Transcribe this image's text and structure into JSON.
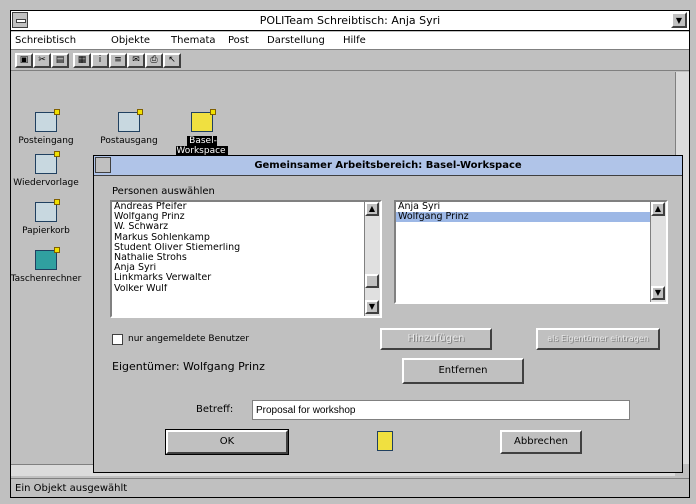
{
  "window": {
    "title": "POLITeam Schreibtisch: Anja Syri"
  },
  "menu": [
    "Schreibtisch",
    "Objekte",
    "Themata",
    "Post",
    "Darstellung",
    "Hilfe"
  ],
  "desktop_icons": [
    {
      "label": "Posteingang"
    },
    {
      "label": "Postausgang"
    },
    {
      "label": "Basel-Workspace"
    },
    {
      "label": "Wiedervorlage"
    },
    {
      "label": "Papierkorb"
    },
    {
      "label": "Taschenrechner"
    }
  ],
  "status": {
    "text": "Ein Objekt ausgewählt"
  },
  "dialog": {
    "title": "Gemeinsamer Arbeitsbereich: Basel-Workspace",
    "persons_label": "Personen auswählen",
    "persons_list": [
      "Andreas Pfeifer",
      "Wolfgang Prinz",
      "W. Schwarz",
      "Markus Sohlenkamp",
      "Student Oliver Stiemerling",
      "Nathalie Strohs",
      "Anja Syri",
      "Linkmarks Verwalter",
      "Volker Wulf"
    ],
    "selected_list": [
      {
        "name": "Anja Syri",
        "selected": false
      },
      {
        "name": "Wolfgang Prinz",
        "selected": true
      }
    ],
    "only_registered_label": "nur angemeldete Benutzer",
    "owner_label": "Eigentümer: Wolfgang Prinz",
    "add_button": "Hinzufügen",
    "owner_button": "als Eigentümer eintragen",
    "remove_button": "Entfernen",
    "subject_label": "Betreff:",
    "subject_value": "Proposal for workshop",
    "ok_button": "OK",
    "cancel_button": "Abbrechen"
  }
}
